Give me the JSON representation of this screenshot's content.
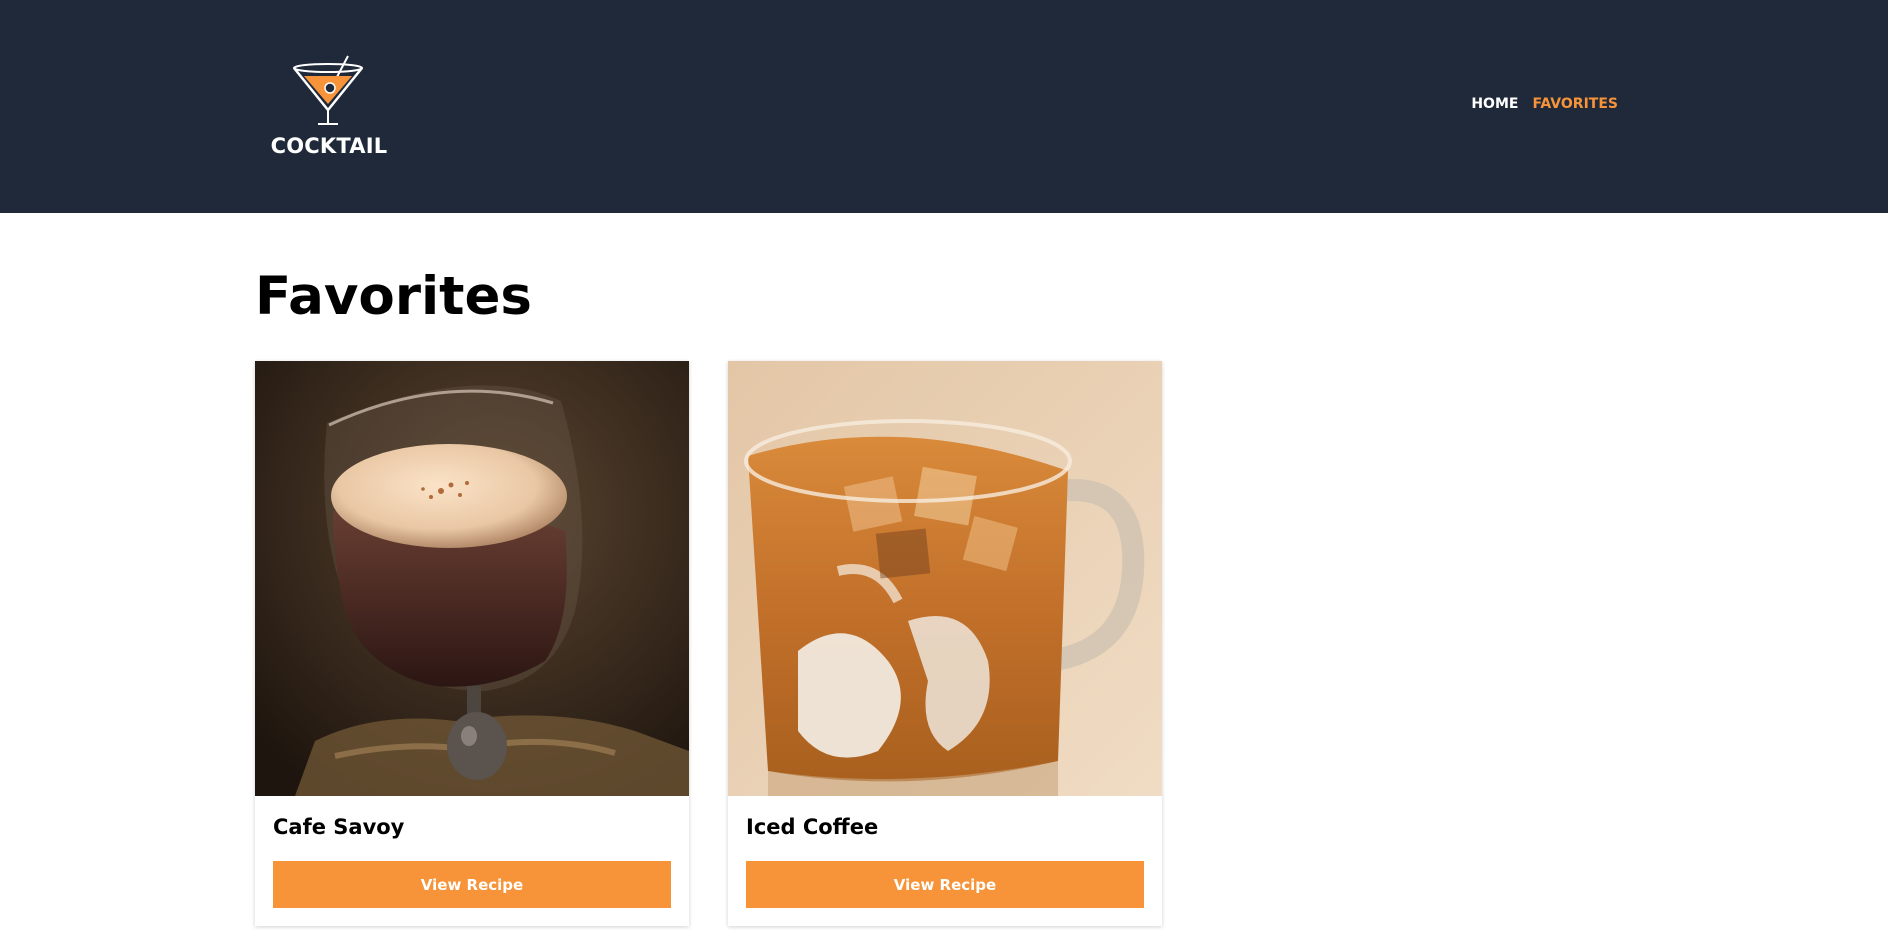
{
  "brand": {
    "logo_text": "COCKTAIL",
    "accent": "#f79439",
    "header_bg": "#1f293a"
  },
  "nav": [
    {
      "label": "HOME",
      "active": false
    },
    {
      "label": "FAVORITES",
      "active": true
    }
  ],
  "page": {
    "title": "Favorites"
  },
  "cards": [
    {
      "name": "Cafe Savoy",
      "button_label": "View Recipe",
      "image": "chocolate-drink-in-stemmed-glass-photo"
    },
    {
      "name": "Iced Coffee",
      "button_label": "View Recipe",
      "image": "iced-coffee-mug-photo"
    }
  ]
}
